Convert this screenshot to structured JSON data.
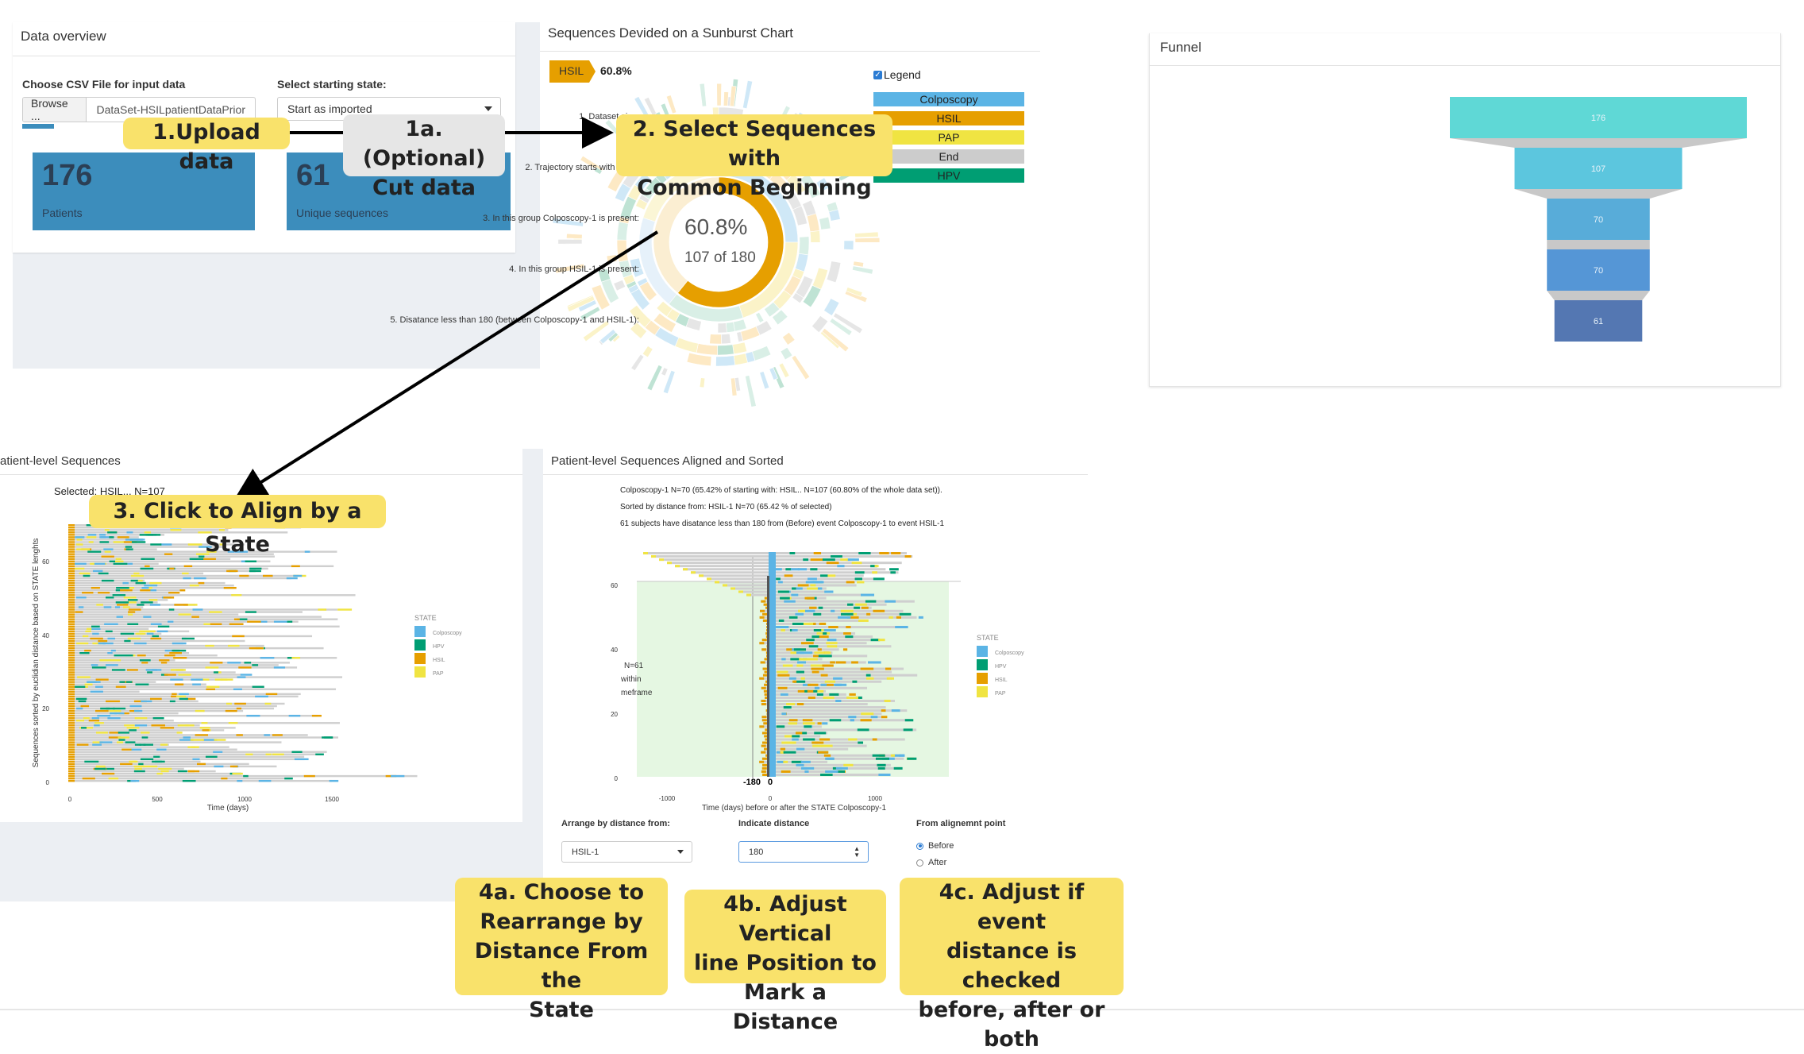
{
  "data_overview": {
    "title": "Data overview",
    "file_label": "Choose CSV File for input data",
    "browse_label": "Browse ...",
    "file_name": "DataSet-HSILpatientDataPrior",
    "start_label": "Select starting state:",
    "start_value": "Start as imported",
    "patients_value": "176",
    "patients_label": "Patients",
    "unique_value": "61",
    "unique_label": "Unique sequences"
  },
  "sunburst": {
    "title": "Sequences Devided on a Sunburst Chart",
    "breadcrumb": "HSIL",
    "breadcrumb_pct": "60.8%",
    "center_pct": "60.8%",
    "center_count": "107 of 180",
    "legend_checkbox": "Legend",
    "legend": [
      {
        "label": "Colposcopy",
        "color": "#5bb4e5"
      },
      {
        "label": "HSIL",
        "color": "#e69f00"
      },
      {
        "label": "PAP",
        "color": "#f0e442"
      },
      {
        "label": "End",
        "color": "#cccccc"
      },
      {
        "label": "HPV",
        "color": "#009e73"
      }
    ]
  },
  "funnel": {
    "title": "Funnel",
    "stages": [
      {
        "label": "1. Dataset size:",
        "value": "176",
        "color": "#5fd8d6"
      },
      {
        "label": "2. Trajectory starts with HSIL:",
        "value": "107",
        "color": "#5cc6de"
      },
      {
        "label": "3. In this group Colposcopy-1 is present:",
        "value": "70",
        "color": "#58acd9"
      },
      {
        "label": "4. In this group HSIL-1 is present:",
        "value": "70",
        "color": "#5596d6"
      },
      {
        "label": "5. Disatance less than 180 (between Colposcopy-1 and HSIL-1):",
        "value": "61",
        "color": "#5477b2"
      }
    ]
  },
  "patient_seq": {
    "title": "atient-level Sequences",
    "selected_text": "Selected: HSIL... N=107",
    "ylabel": "Sequences sorted by euclidian distance based on STATE lenghts",
    "xlabel": "Time (days)",
    "xticks": [
      "0",
      "500",
      "1000",
      "1500"
    ],
    "yticks": [
      "0",
      "20",
      "40",
      "60"
    ],
    "legend_title": "STATE",
    "legend": [
      "Colposcopy",
      "HPV",
      "HSIL",
      "PAP"
    ]
  },
  "aligned": {
    "title": "Patient-level Sequences Aligned and Sorted",
    "line1": "Colposcopy-1 N=70 (65.42% of starting with: HSIL.. N=107 (60.80% of the whole data set)).",
    "line2": "Sorted by distance from: HSIL-1 N=70 (65.42 % of selected)",
    "line3": "61 subjects have disatance less than 180 from (Before) event Colposcopy-1 to event HSIL-1",
    "within_n": "N=61",
    "within_w": "within",
    "within_t": "meframe",
    "marker_neg": "-180",
    "marker_zero": "0",
    "xticks": [
      "-1000",
      "0",
      "1000"
    ],
    "yticks": [
      "0",
      "20",
      "40",
      "60"
    ],
    "xlabel": "Time (days) before or after the STATE Colposcopy-1",
    "legend_title": "STATE",
    "legend": [
      "Colposcopy",
      "HPV",
      "HSIL",
      "PAP"
    ],
    "arrange_label": "Arrange by distance from:",
    "arrange_value": "HSIL-1",
    "distance_label": "Indicate distance",
    "distance_value": "180",
    "point_label": "From alignemnt point",
    "before_label": "Before",
    "after_label": "After"
  },
  "callouts": {
    "upload": "1.Upload data",
    "cut1": "1a. (Optional)",
    "cut2": "Cut data",
    "select1": "2. Select Sequences with",
    "select2": "Common Beginning",
    "align": "3. Click to Align by a State",
    "c4a_1": "4a. Choose to",
    "c4a_2": "Rearrange by",
    "c4a_3": "Distance From the",
    "c4a_4": "State",
    "c4b_1": "4b. Adjust Vertical",
    "c4b_2": "line Position to",
    "c4b_3": "Mark a Distance",
    "c4c_1": "4c. Adjust if event",
    "c4c_2": "distance is checked",
    "c4c_3": "before, after or",
    "c4c_4": "both"
  }
}
